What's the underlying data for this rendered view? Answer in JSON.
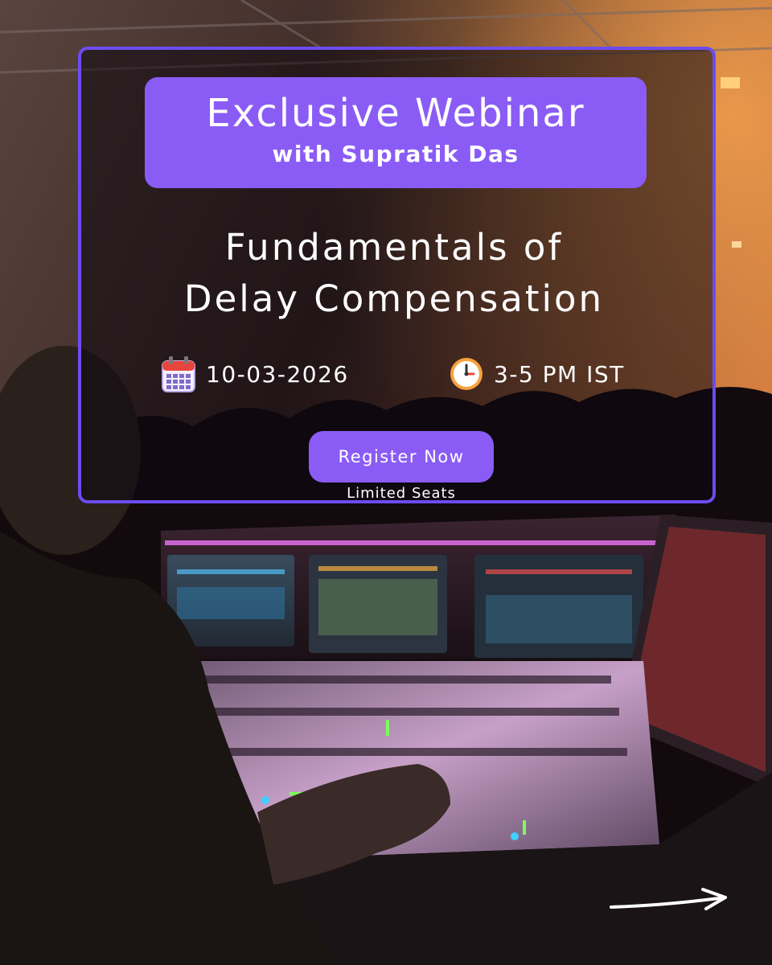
{
  "header": {
    "title": "Exclusive Webinar",
    "subtitle": "with Supratik Das"
  },
  "talk": {
    "title_line1": "Fundamentals of",
    "title_line2": "Delay Compensation"
  },
  "event": {
    "date": "10-03-2026",
    "date_icon": "calendar-icon",
    "time": "3-5 PM IST",
    "time_icon": "clock-icon"
  },
  "cta": {
    "register_label": "Register Now",
    "note": "Limited Seats",
    "next_icon": "arrow-right-icon"
  },
  "colors": {
    "accent": "#8a5cf5",
    "border": "#6d4cf0",
    "text": "#ffffff"
  }
}
